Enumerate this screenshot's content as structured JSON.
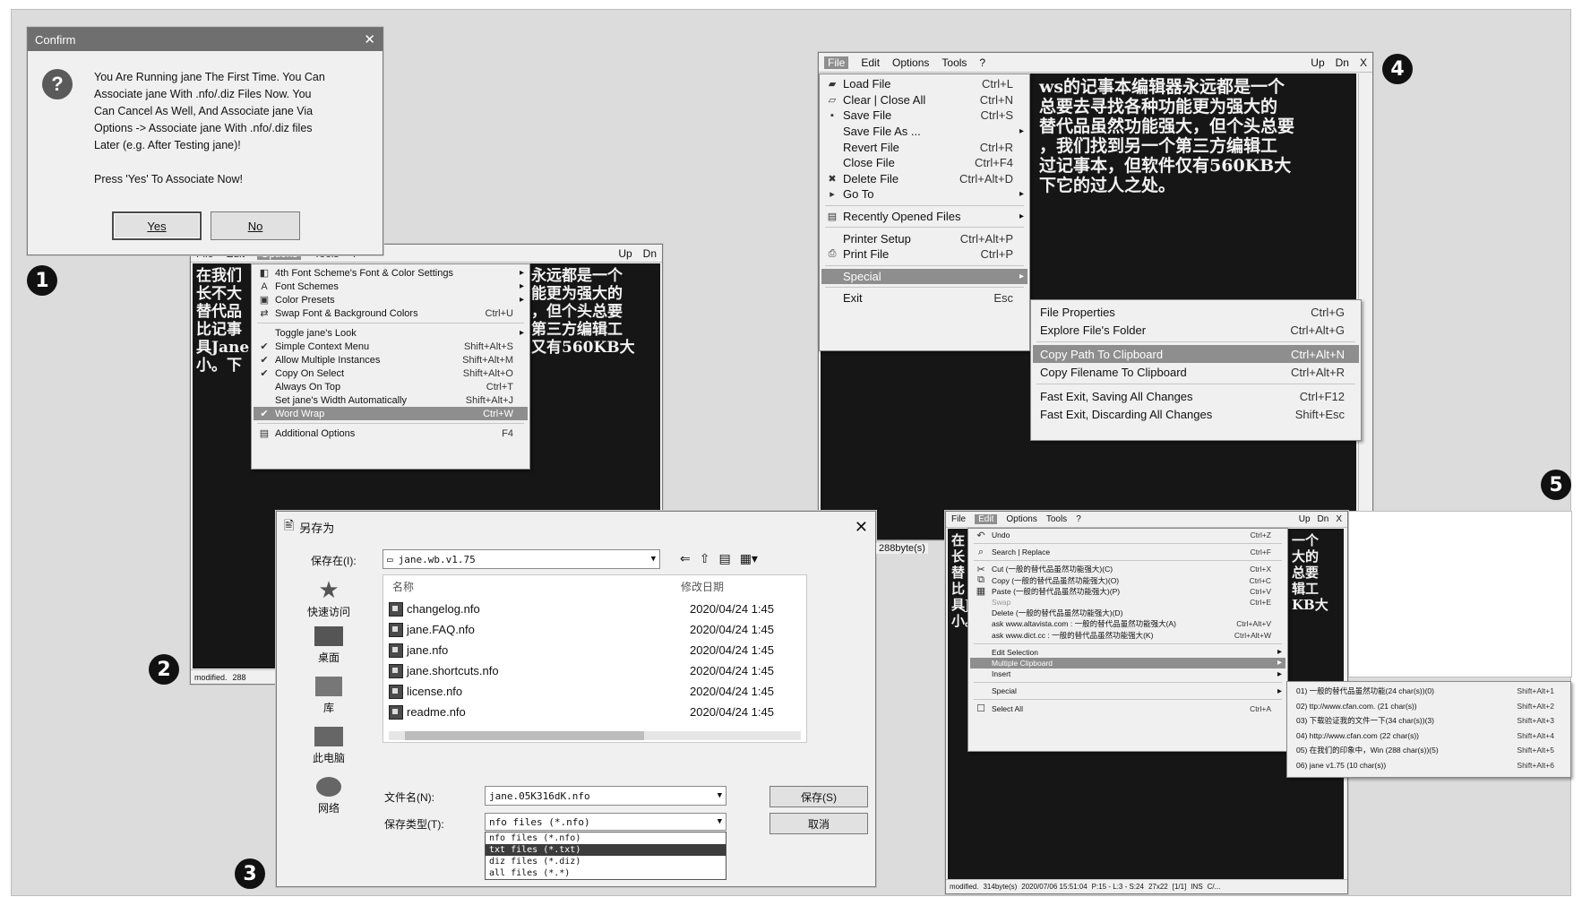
{
  "confirm_dialog": {
    "title": "Confirm",
    "lines": [
      "You Are Running jane The First Time. You Can",
      "Associate jane With .nfo/.diz Files Now. You",
      "Can Cancel As Well, And Associate jane Via",
      "Options -> Associate jane With .nfo/.diz files",
      "Later (e.g. After Testing jane)!"
    ],
    "prompt": "Press 'Yes' To Associate Now!",
    "yes_label": "Yes",
    "no_label": "No"
  },
  "win2": {
    "menu": [
      "File",
      "Edit",
      "Options",
      "Tools",
      "?"
    ],
    "right_controls": [
      "Up",
      "Dn"
    ],
    "text_lines": [
      "在我们",
      "长不大",
      "替代品",
      "比记事",
      "具Jane",
      "小。下"
    ],
    "right_text_lines": [
      "永远都是一个",
      "能更为强大的",
      "，但个头总要",
      "第三方编辑工",
      "又有560KB大"
    ],
    "status": [
      "modified.",
      "288"
    ],
    "options_menu": [
      {
        "icon": "palette-icon",
        "label": "4th Font Scheme's Font & Color Settings",
        "shortcut": "",
        "arrow": true
      },
      {
        "icon": "font-icon",
        "label": "Font Schemes",
        "shortcut": "",
        "arrow": true
      },
      {
        "icon": "color-icon",
        "label": "Color Presets",
        "shortcut": "",
        "arrow": true
      },
      {
        "icon": "swap-icon",
        "label": "Swap Font & Background Colors",
        "shortcut": "Ctrl+U",
        "arrow": false
      },
      {
        "sep": true
      },
      {
        "icon": "",
        "label": "Toggle jane's Look",
        "shortcut": "",
        "arrow": true
      },
      {
        "icon": "check-icon",
        "label": "Simple Context Menu",
        "shortcut": "Shift+Alt+S",
        "arrow": false
      },
      {
        "icon": "check-icon",
        "label": "Allow Multiple Instances",
        "shortcut": "Shift+Alt+M",
        "arrow": false
      },
      {
        "icon": "check-icon",
        "label": "Copy On Select",
        "shortcut": "Shift+Alt+O",
        "arrow": false
      },
      {
        "icon": "",
        "label": "Always On Top",
        "shortcut": "Ctrl+T",
        "arrow": false
      },
      {
        "icon": "",
        "label": "Set jane's Width Automatically",
        "shortcut": "Shift+Alt+J",
        "arrow": false
      },
      {
        "icon": "check-icon",
        "label": "Word Wrap",
        "shortcut": "Ctrl+W",
        "arrow": false,
        "highlight": true
      },
      {
        "sep": true
      },
      {
        "icon": "options-icon",
        "label": "Additional Options",
        "shortcut": "F4",
        "arrow": false
      }
    ]
  },
  "save_dialog": {
    "title": "另存为",
    "save_in_label": "保存在(I):",
    "save_in_value": "jane.wb.v1.75",
    "col_name": "名称",
    "col_date": "修改日期",
    "places": [
      "快速访问",
      "桌面",
      "库",
      "此电脑",
      "网络"
    ],
    "files": [
      {
        "name": "changelog.nfo",
        "date": "2020/04/24 1:45"
      },
      {
        "name": "jane.FAQ.nfo",
        "date": "2020/04/24 1:45"
      },
      {
        "name": "jane.nfo",
        "date": "2020/04/24 1:45"
      },
      {
        "name": "jane.shortcuts.nfo",
        "date": "2020/04/24 1:45"
      },
      {
        "name": "license.nfo",
        "date": "2020/04/24 1:45"
      },
      {
        "name": "readme.nfo",
        "date": "2020/04/24 1:45"
      }
    ],
    "filename_label": "文件名(N):",
    "filename_value": "jane.05K316dK.nfo",
    "filetype_label": "保存类型(T):",
    "filetype_value": "nfo files (*.nfo)",
    "filetype_options": [
      "nfo files (*.nfo)",
      "txt files (*.txt)",
      "diz files (*.diz)",
      "all files (*.*)"
    ],
    "save_button": "保存(S)",
    "cancel_button": "取消",
    "peek_status": "288byte(s)"
  },
  "win4": {
    "menu": [
      "File",
      "Edit",
      "Options",
      "Tools",
      "?"
    ],
    "right_controls": [
      "Up",
      "Dn",
      "X"
    ],
    "text_lines": [
      "ws的记事本编辑器永远都是一个",
      "总要去寻找各种功能更为强大的",
      "替代品虽然功能强大，但个头总要",
      "，我们找到另一个第三方编辑工",
      "过记事本，但软件仅有560KB大",
      "下它的过人之处。"
    ],
    "file_menu": [
      {
        "icon": "folder-open-icon",
        "label": "Load File",
        "shortcut": "Ctrl+L",
        "arrow": false
      },
      {
        "icon": "clear-icon",
        "label": "Clear | Close All",
        "shortcut": "Ctrl+N",
        "arrow": false
      },
      {
        "icon": "save-icon",
        "label": "Save File",
        "shortcut": "Ctrl+S",
        "arrow": false
      },
      {
        "icon": "",
        "label": "Save File As ...",
        "shortcut": "",
        "arrow": true
      },
      {
        "icon": "",
        "label": "Revert File",
        "shortcut": "Ctrl+R",
        "arrow": false
      },
      {
        "icon": "",
        "label": "Close File",
        "shortcut": "Ctrl+F4",
        "arrow": false
      },
      {
        "icon": "delete-icon",
        "label": "Delete File",
        "shortcut": "Ctrl+Alt+D",
        "arrow": false
      },
      {
        "icon": "goto-icon",
        "label": "Go To",
        "shortcut": "",
        "arrow": true
      },
      {
        "sep": true
      },
      {
        "icon": "recent-icon",
        "label": "Recently Opened Files",
        "shortcut": "",
        "arrow": true
      },
      {
        "sep": true
      },
      {
        "icon": "",
        "label": "Printer Setup",
        "shortcut": "Ctrl+Alt+P",
        "arrow": false
      },
      {
        "icon": "print-icon",
        "label": "Print File",
        "shortcut": "Ctrl+P",
        "arrow": false
      },
      {
        "sep": true
      },
      {
        "icon": "",
        "label": "Special",
        "shortcut": "",
        "arrow": true,
        "highlight": true
      },
      {
        "sep": true
      },
      {
        "icon": "",
        "label": "Exit",
        "shortcut": "Esc",
        "arrow": false
      }
    ],
    "special_menu": [
      {
        "label": "File Properties",
        "shortcut": "Ctrl+G"
      },
      {
        "label": "Explore File's Folder",
        "shortcut": "Ctrl+Alt+G"
      },
      {
        "sep": true
      },
      {
        "label": "Copy Path To Clipboard",
        "shortcut": "Ctrl+Alt+N",
        "highlight": true
      },
      {
        "label": "Copy Filename To Clipboard",
        "shortcut": "Ctrl+Alt+R"
      },
      {
        "sep": true
      },
      {
        "label": "Fast Exit, Saving All Changes",
        "shortcut": "Ctrl+F12"
      },
      {
        "label": "Fast Exit, Discarding All Changes",
        "shortcut": "Shift+Esc"
      }
    ]
  },
  "win5": {
    "menu": [
      "File",
      "Edit",
      "Options",
      "Tools",
      "?"
    ],
    "right_controls": [
      "Up",
      "Dn",
      "X"
    ],
    "text_lines": [
      "在",
      "长",
      "替",
      "比",
      "具J",
      "小。"
    ],
    "right_text_lines": [
      "一个",
      "大的",
      "总要",
      "辑工",
      "KB大"
    ],
    "status": [
      "modified.",
      "314byte(s)",
      "2020/07/06 15:51:04",
      "P:15 - L:3 - S:24",
      "27x22",
      "[1/1]",
      "INS",
      "C/..."
    ],
    "edit_menu": [
      {
        "icon": "undo-icon",
        "label": "Undo",
        "shortcut": "Ctrl+Z"
      },
      {
        "sep": true
      },
      {
        "icon": "search-icon",
        "label": "Search | Replace",
        "shortcut": "Ctrl+F"
      },
      {
        "sep": true
      },
      {
        "icon": "cut-icon",
        "label": "Cut (一般的替代品虽然功能强大)(C)",
        "shortcut": "Ctrl+X"
      },
      {
        "icon": "copy-icon",
        "label": "Copy (一般的替代品虽然功能强大)(O)",
        "shortcut": "Ctrl+C"
      },
      {
        "icon": "paste-icon",
        "label": "Paste (一般的替代品虽然功能强大)(P)",
        "shortcut": "Ctrl+V"
      },
      {
        "icon": "",
        "label": "Swap",
        "shortcut": "Ctrl+E",
        "disabled": true
      },
      {
        "icon": "",
        "label": "Delete (一般的替代品虽然功能强大)(D)",
        "shortcut": ""
      },
      {
        "icon": "",
        "label": "ask www.altavista.com : 一般的替代品虽然功能强大(A)",
        "shortcut": "Ctrl+Alt+V"
      },
      {
        "icon": "",
        "label": "ask www.dict.cc : 一般的替代品虽然功能强大(K)",
        "shortcut": "Ctrl+Alt+W"
      },
      {
        "sep": true
      },
      {
        "icon": "",
        "label": "Edit Selection",
        "shortcut": "",
        "arrow": true
      },
      {
        "icon": "",
        "label": "Multiple Clipboard",
        "shortcut": "",
        "arrow": true,
        "highlight": true
      },
      {
        "icon": "",
        "label": "Insert",
        "shortcut": "",
        "arrow": true
      },
      {
        "sep": true
      },
      {
        "icon": "",
        "label": "Special",
        "shortcut": "",
        "arrow": true
      },
      {
        "sep": true
      },
      {
        "icon": "select-all-icon",
        "label": "Select All",
        "shortcut": "Ctrl+A"
      }
    ],
    "clipboard_menu": [
      {
        "label": "01) 一般的替代品虽然功能(24 char(s))(0)",
        "shortcut": "Shift+Alt+1"
      },
      {
        "label": "02) ttp://www.cfan.com. (21 char(s))",
        "shortcut": "Shift+Alt+2"
      },
      {
        "label": "03) 下载验证我的文件一下(34 char(s))(3)",
        "shortcut": "Shift+Alt+3"
      },
      {
        "label": "04) http://www.cfan.com (22 char(s))",
        "shortcut": "Shift+Alt+4"
      },
      {
        "label": "05) 在我们的印象中，Win (288 char(s))(5)",
        "shortcut": "Shift+Alt+5"
      },
      {
        "label": "06) jane v1.75 (10 char(s))",
        "shortcut": "Shift+Alt+6"
      }
    ]
  },
  "badges": [
    "1",
    "2",
    "3",
    "4",
    "5"
  ],
  "colors": {
    "highlight": "#8e8e8e",
    "editor_bg": "#161616",
    "editor_text": "#f2f2f2",
    "menu_bg": "#f0f0f0"
  }
}
